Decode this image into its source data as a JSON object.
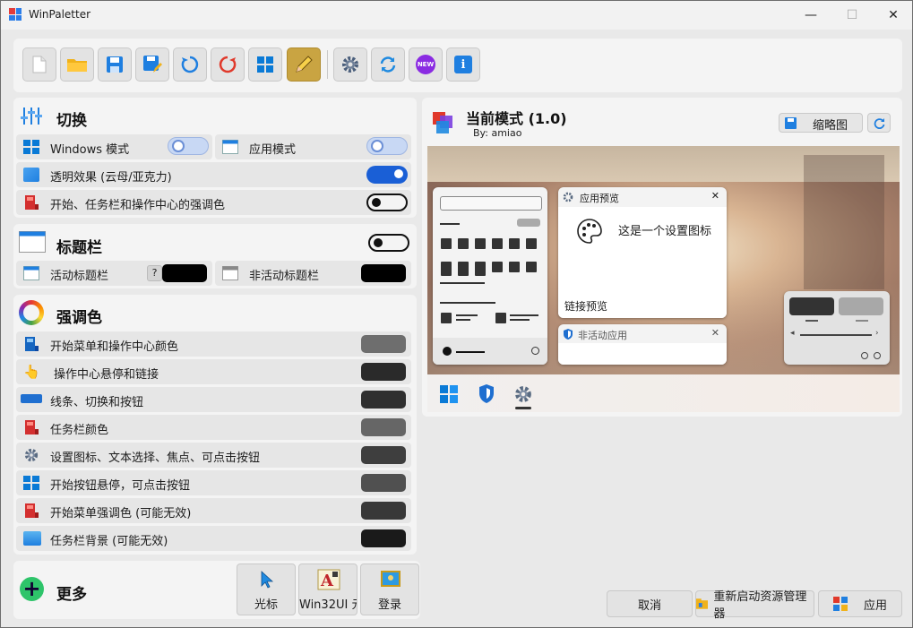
{
  "window": {
    "title": "WinPaletter",
    "minimize": "—",
    "maximize": "☐",
    "close": "✕"
  },
  "toolbar": {
    "buttons": [
      "new-file-icon",
      "open-folder-icon",
      "save-icon",
      "save-as-icon",
      "undo-icon",
      "revert-icon",
      "windows-icon",
      "edit-icon",
      "settings-icon",
      "sync-icon",
      "new-badge-icon",
      "info-icon"
    ],
    "new_badge": "NEW",
    "info_glyph": "i"
  },
  "switch_section": {
    "title": "切换",
    "windows_mode": "Windows 模式",
    "app_mode": "应用模式",
    "transparency": "透明效果 (云母/亚克力)",
    "accent_on_start": "开始、任务栏和操作中心的强调色"
  },
  "titlebar_section": {
    "title": "标题栏",
    "active": "活动标题栏",
    "help": "?",
    "inactive": "非活动标题栏"
  },
  "accent_section": {
    "title": "强调色",
    "rows": [
      {
        "label": "开始菜单和操作中心颜色",
        "color": "#6e6e6e"
      },
      {
        "label": "操作中心悬停和链接",
        "color": "#2a2a2a"
      },
      {
        "label": "线条、切换和按钮",
        "color": "#2f2f2f"
      },
      {
        "label": "任务栏颜色",
        "color": "#666666"
      },
      {
        "label": "设置图标、文本选择、焦点、可点击按钮",
        "color": "#3e3e3e"
      },
      {
        "label": "开始按钮悬停，可点击按钮",
        "color": "#505050"
      },
      {
        "label": "开始菜单强调色 (可能无效)",
        "color": "#383838"
      },
      {
        "label": "任务栏背景 (可能无效)",
        "color": "#1a1a1a"
      }
    ]
  },
  "more_section": {
    "title": "更多",
    "plus": "+"
  },
  "more_buttons": {
    "cursor": "光标",
    "win32": "Win32UI 元",
    "login": "登录"
  },
  "current_mode": {
    "title": "当前模式 (1.0)",
    "author": "By: amiao",
    "thumbnail": "缩略图"
  },
  "preview": {
    "app_preview": "应用预览",
    "settings_text": "这是一个设置图标",
    "link_preview": "链接预览",
    "inactive_app": "非活动应用",
    "close": "✕"
  },
  "actions": {
    "cancel": "取消",
    "restart_explorer": "重新启动资源管理器",
    "apply": "应用"
  },
  "colors": {
    "accent_blue": "#1a5fd6",
    "active_tool": "#c9a442",
    "titlebar_swatch": "#000000"
  }
}
